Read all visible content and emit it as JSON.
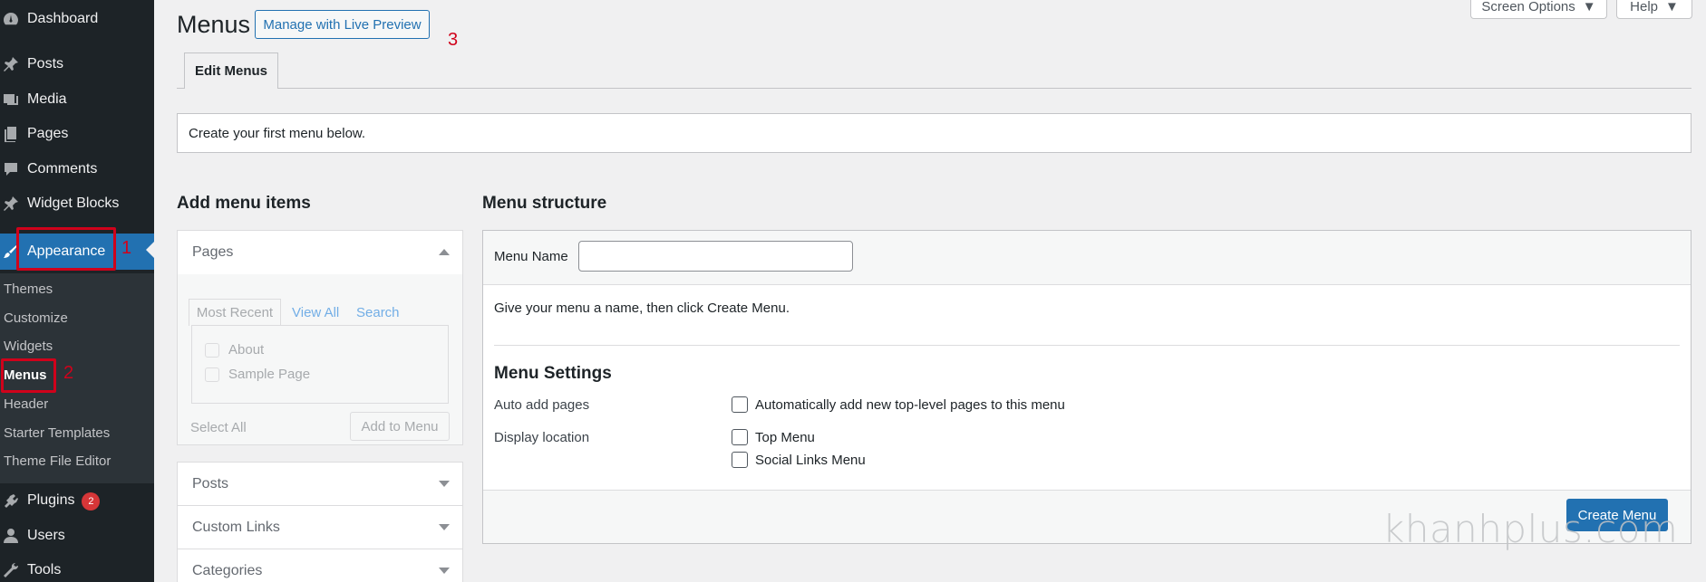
{
  "sidebar": {
    "items": [
      {
        "label": "Dashboard",
        "icon": "dashboard-icon"
      },
      {
        "label": "Posts",
        "icon": "pin-icon"
      },
      {
        "label": "Media",
        "icon": "media-icon"
      },
      {
        "label": "Pages",
        "icon": "pages-icon"
      },
      {
        "label": "Comments",
        "icon": "comments-icon"
      },
      {
        "label": "Widget Blocks",
        "icon": "pin-icon"
      },
      {
        "label": "Appearance",
        "icon": "paintbrush-icon"
      },
      {
        "label": "Plugins",
        "icon": "plugin-icon",
        "badge": "2"
      },
      {
        "label": "Users",
        "icon": "users-icon"
      },
      {
        "label": "Tools",
        "icon": "wrench-icon"
      }
    ],
    "submenu": [
      "Themes",
      "Customize",
      "Widgets",
      "Menus",
      "Header",
      "Starter Templates",
      "Theme File Editor"
    ]
  },
  "annotations": {
    "one": "1",
    "two": "2",
    "three": "3"
  },
  "header": {
    "title": "Menus",
    "live_preview": "Manage with Live Preview",
    "screen_options": "Screen Options",
    "help": "Help",
    "tab": "Edit Menus"
  },
  "notice": "Create your first menu below.",
  "add_items": {
    "heading": "Add menu items",
    "pages": {
      "title": "Pages",
      "tabs": [
        "Most Recent",
        "View All",
        "Search"
      ],
      "items": [
        "About",
        "Sample Page"
      ],
      "select_all": "Select All",
      "add_button": "Add to Menu"
    },
    "sections": [
      "Posts",
      "Custom Links",
      "Categories"
    ]
  },
  "structure": {
    "heading": "Menu structure",
    "name_label": "Menu Name",
    "name_value": "",
    "instructions": "Give your menu a name, then click Create Menu.",
    "settings_heading": "Menu Settings",
    "auto_add_label": "Auto add pages",
    "auto_add_option": "Automatically add new top-level pages to this menu",
    "display_label": "Display location",
    "locations": [
      "Top Menu",
      "Social Links Menu"
    ],
    "create_button": "Create Menu"
  },
  "watermark": "khanhplus.com",
  "colors": {
    "sidebar": "#1d2327",
    "submenu": "#2c3338",
    "accent": "#2271b1",
    "annotation": "#d0021b",
    "badge": "#d63638"
  }
}
